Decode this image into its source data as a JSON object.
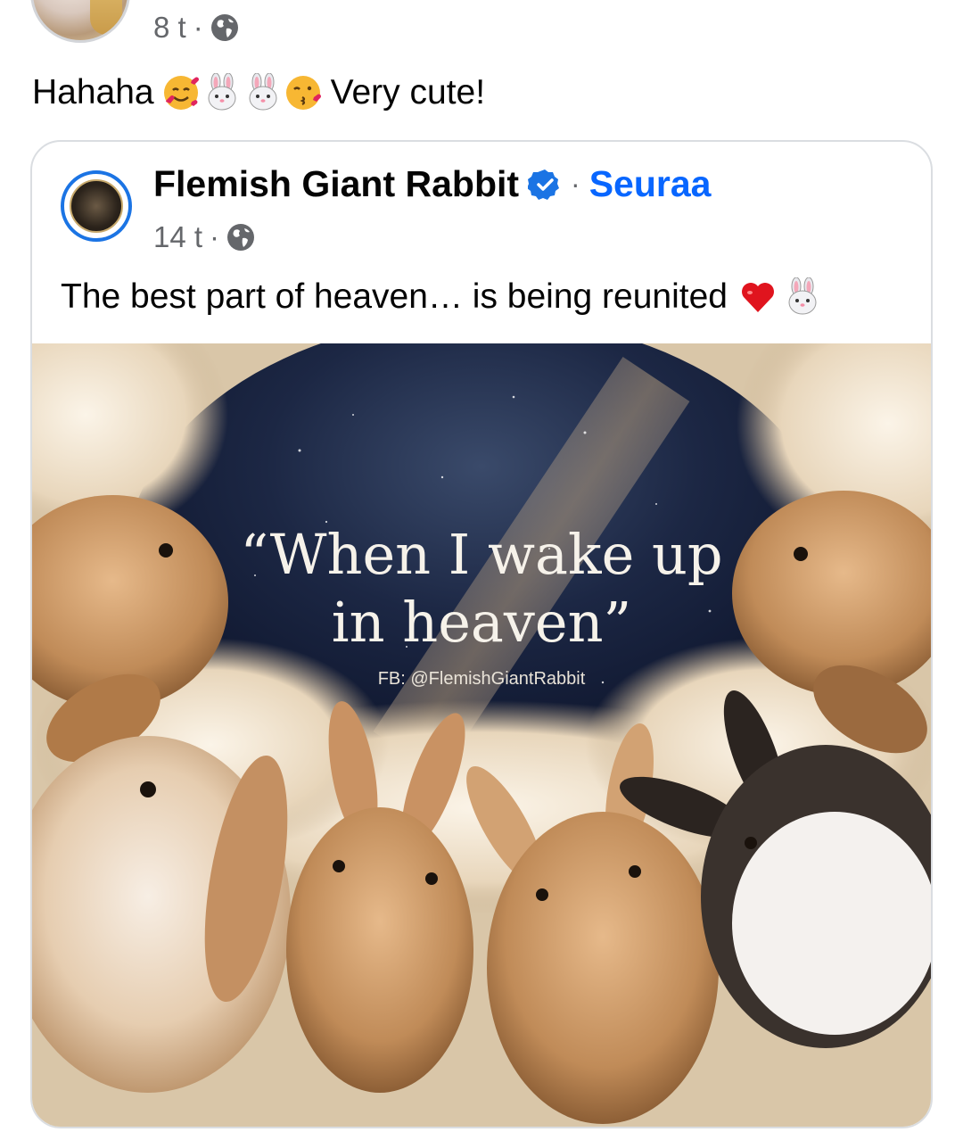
{
  "comment": {
    "time": "8 t",
    "text_prefix": "Hahaha",
    "emojis": [
      "smiling-face-with-hearts",
      "rabbit-face",
      "rabbit-face",
      "face-blowing-kiss"
    ],
    "text_suffix": "Very cute!"
  },
  "shared_post": {
    "page_name": "Flemish Giant Rabbit",
    "verified": true,
    "follow_label": "Seuraa",
    "time": "14 t",
    "text": "The best part of heaven… is being reunited",
    "text_emojis": [
      "red-heart",
      "rabbit-face"
    ],
    "image": {
      "quote_line1": "“When I wake up",
      "quote_line2": "in heaven”",
      "credit": "FB: @FlemishGiantRabbit"
    }
  },
  "colors": {
    "link_blue": "#0866ff",
    "verified_blue": "#1b74e4",
    "meta_gray": "#65676b"
  }
}
